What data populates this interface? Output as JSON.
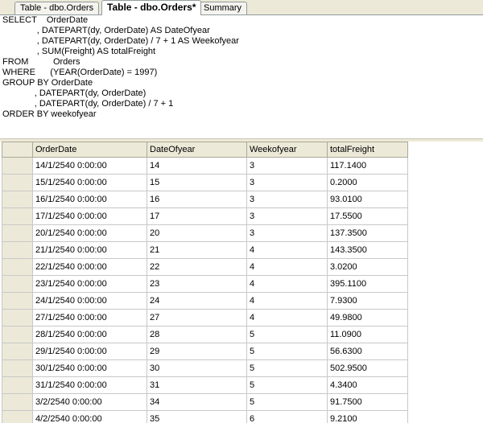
{
  "tabs": [
    {
      "label": "Table - dbo.Orders",
      "active": false
    },
    {
      "label": "Table - dbo.Orders*",
      "active": true
    },
    {
      "label": "Summary",
      "active": false
    }
  ],
  "sql": [
    "SELECT    OrderDate",
    "              , DATEPART(dy, OrderDate) AS DateOfyear",
    "              , DATEPART(dy, OrderDate) / 7 + 1 AS Weekofyear",
    "              , SUM(Freight) AS totalFreight",
    "FROM          Orders",
    "WHERE      (YEAR(OrderDate) = 1997)",
    "GROUP BY OrderDate",
    "             , DATEPART(dy, OrderDate)",
    "             , DATEPART(dy, OrderDate) / 7 + 1",
    "ORDER BY weekofyear"
  ],
  "grid": {
    "columns": [
      "OrderDate",
      "DateOfyear",
      "Weekofyear",
      "totalFreight"
    ],
    "rows": [
      [
        "14/1/2540 0:00:00",
        "14",
        "3",
        "117.1400"
      ],
      [
        "15/1/2540 0:00:00",
        "15",
        "3",
        "0.2000"
      ],
      [
        "16/1/2540 0:00:00",
        "16",
        "3",
        "93.0100"
      ],
      [
        "17/1/2540 0:00:00",
        "17",
        "3",
        "17.5500"
      ],
      [
        "20/1/2540 0:00:00",
        "20",
        "3",
        "137.3500"
      ],
      [
        "21/1/2540 0:00:00",
        "21",
        "4",
        "143.3500"
      ],
      [
        "22/1/2540 0:00:00",
        "22",
        "4",
        "3.0200"
      ],
      [
        "23/1/2540 0:00:00",
        "23",
        "4",
        "395.1100"
      ],
      [
        "24/1/2540 0:00:00",
        "24",
        "4",
        "7.9300"
      ],
      [
        "27/1/2540 0:00:00",
        "27",
        "4",
        "49.9800"
      ],
      [
        "28/1/2540 0:00:00",
        "28",
        "5",
        "11.0900"
      ],
      [
        "29/1/2540 0:00:00",
        "29",
        "5",
        "56.6300"
      ],
      [
        "30/1/2540 0:00:00",
        "30",
        "5",
        "502.9500"
      ],
      [
        "31/1/2540 0:00:00",
        "31",
        "5",
        "4.3400"
      ],
      [
        "3/2/2540 0:00:00",
        "34",
        "5",
        "91.7500"
      ],
      [
        "4/2/2540 0:00:00",
        "35",
        "6",
        "9.2100"
      ]
    ]
  }
}
